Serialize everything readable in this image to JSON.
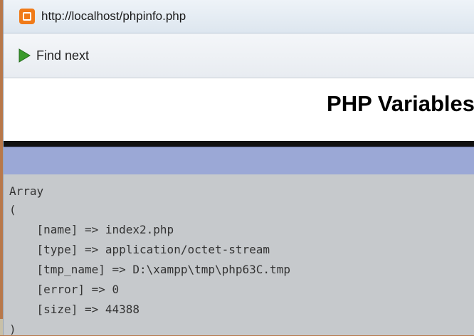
{
  "window": {
    "url": "http://localhost/phpinfo.php"
  },
  "findbar": {
    "find_next_label": "Find next"
  },
  "page": {
    "title": "PHP Variables"
  },
  "dump": {
    "lines": [
      "Array",
      "(",
      "    [name] => index2.php",
      "    [type] => application/octet-stream",
      "    [tmp_name] => D:\\xampp\\tmp\\php63C.tmp",
      "    [error] => 0",
      "    [size] => 44388",
      ")"
    ]
  },
  "colors": {
    "header_band": "#9ba8d6",
    "code_background": "#c6c9cc",
    "app_icon": "#f07a18"
  }
}
